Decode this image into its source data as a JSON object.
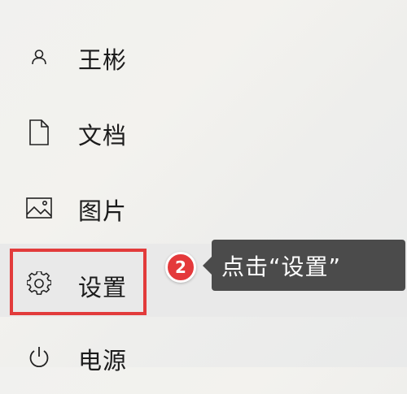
{
  "menu": {
    "items": [
      {
        "label": "王彬",
        "icon": "user-icon"
      },
      {
        "label": "文档",
        "icon": "document-icon"
      },
      {
        "label": "图片",
        "icon": "picture-icon"
      },
      {
        "label": "设置",
        "icon": "gear-icon"
      },
      {
        "label": "电源",
        "icon": "power-icon"
      }
    ]
  },
  "annotation": {
    "step_number": "2",
    "callout_text": "点击“设置”",
    "highlight_color": "#e23b3b",
    "badge_color": "#e4393b",
    "callout_color": "#4b4b4b"
  }
}
